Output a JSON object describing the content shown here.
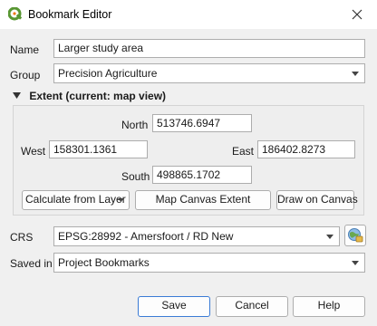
{
  "window": {
    "title": "Bookmark Editor"
  },
  "form": {
    "name_label": "Name",
    "name_value": "Larger study area",
    "group_label": "Group",
    "group_value": "Precision Agriculture",
    "extent_header": "Extent (current: map view)",
    "north_label": "North",
    "north_value": "513746.6947",
    "west_label": "West",
    "west_value": "158301.1361",
    "east_label": "East",
    "east_value": "186402.8273",
    "south_label": "South",
    "south_value": "498865.1702",
    "calc_layer_label": "Calculate from Layer",
    "map_canvas_label": "Map Canvas Extent",
    "draw_canvas_label": "Draw on Canvas",
    "crs_label": "CRS",
    "crs_value": "EPSG:28992 - Amersfoort / RD New",
    "saved_in_label": "Saved in",
    "saved_in_value": "Project Bookmarks"
  },
  "buttons": {
    "save": "Save",
    "cancel": "Cancel",
    "help": "Help"
  },
  "colors": {
    "qgis_green": "#589632",
    "qgis_yellow": "#ee7913",
    "accent": "#3a7bd5"
  },
  "icons": [
    "qgis-logo-icon",
    "close-icon",
    "chevron-down-icon",
    "collapse-triangle-icon",
    "crs-globe-icon"
  ]
}
